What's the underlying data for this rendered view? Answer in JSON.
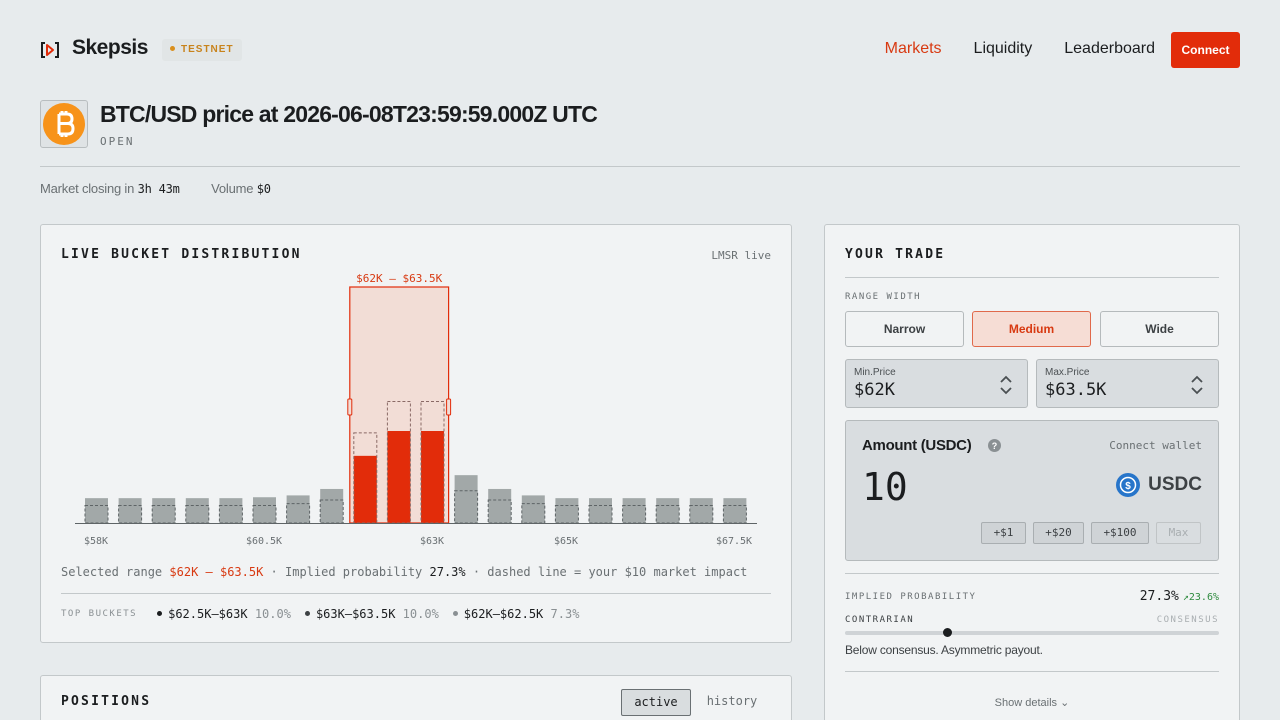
{
  "header": {
    "brand": "Skepsis",
    "badge": "TESTNET",
    "nav": [
      "Markets",
      "Liquidity",
      "Leaderboard"
    ],
    "active_nav": "Markets",
    "connect_label": "Connect"
  },
  "market": {
    "title": "BTC/USD price at 2026-06-08T23:59:59.000Z UTC",
    "status": "OPEN",
    "closing_label": "Market closing in",
    "closing_value": "3h 43m",
    "volume_label": "Volume",
    "volume_value": "$0"
  },
  "distribution": {
    "title": "LIVE BUCKET DISTRIBUTION",
    "live_label": "LMSR live",
    "selection_label": "$62K – $63.5K",
    "summary": {
      "prefix": "Selected range",
      "range": "$62K – $63.5K",
      "sep1": "· Implied probability",
      "prob": "27.3%",
      "suffix": "· dashed line = your $10 market impact"
    },
    "top_buckets_label": "TOP BUCKETS",
    "top_buckets": [
      {
        "range": "$62.5K–$63K",
        "pct": "10.0%",
        "color": "#1b1d1f"
      },
      {
        "range": "$63K–$63.5K",
        "pct": "10.0%",
        "color": "#3d4144"
      },
      {
        "range": "$62K–$62.5K",
        "pct": "7.3%",
        "color": "#8a9093"
      }
    ]
  },
  "chart_data": {
    "type": "bar",
    "x_ticks": [
      "$58K",
      "$60.5K",
      "$63K",
      "$65K",
      "$67.5K"
    ],
    "values": [
      2.7,
      2.7,
      2.7,
      2.7,
      2.7,
      2.8,
      3.0,
      3.7,
      7.3,
      10.0,
      10.0,
      5.2,
      3.7,
      3.0,
      2.7,
      2.7,
      2.7,
      2.7,
      2.7,
      2.7
    ],
    "impact_values": [
      1.9,
      1.9,
      1.9,
      1.9,
      1.9,
      1.9,
      2.1,
      2.5,
      9.8,
      13.2,
      13.2,
      3.5,
      2.5,
      2.1,
      1.9,
      1.9,
      1.9,
      1.9,
      1.9,
      1.9
    ],
    "selected_range": [
      8,
      10
    ],
    "colors": {
      "bar": "#a2a8a8",
      "selected": "#e22c0a",
      "selection_fill": "#f2ddd6",
      "accent": "#d83a12"
    }
  },
  "positions": {
    "title": "POSITIONS",
    "tabs": [
      "active",
      "history"
    ]
  },
  "trade": {
    "title": "YOUR TRADE",
    "range_width_label": "RANGE WIDTH",
    "widths": [
      "Narrow",
      "Medium",
      "Wide"
    ],
    "selected_width": "Medium",
    "min_price_label": "Min.Price",
    "min_price": "$62K",
    "max_price_label": "Max.Price",
    "max_price": "$63.5K",
    "amount_label": "Amount (USDC)",
    "connect_wallet": "Connect wallet",
    "amount_value": "10",
    "currency": "USDC",
    "quick_amounts": [
      "+$1",
      "+$20",
      "+$100",
      "Max"
    ],
    "implied_prob_label": "IMPLIED PROBABILITY",
    "implied_prob": "27.3%",
    "implied_change": "↗23.6%",
    "contrarian_label": "CONTRARIAN",
    "consensus_label": "CONSENSUS",
    "consensus_position": 0.27,
    "note": "Below consensus. Asymmetric payout.",
    "show_details": "Show details"
  }
}
